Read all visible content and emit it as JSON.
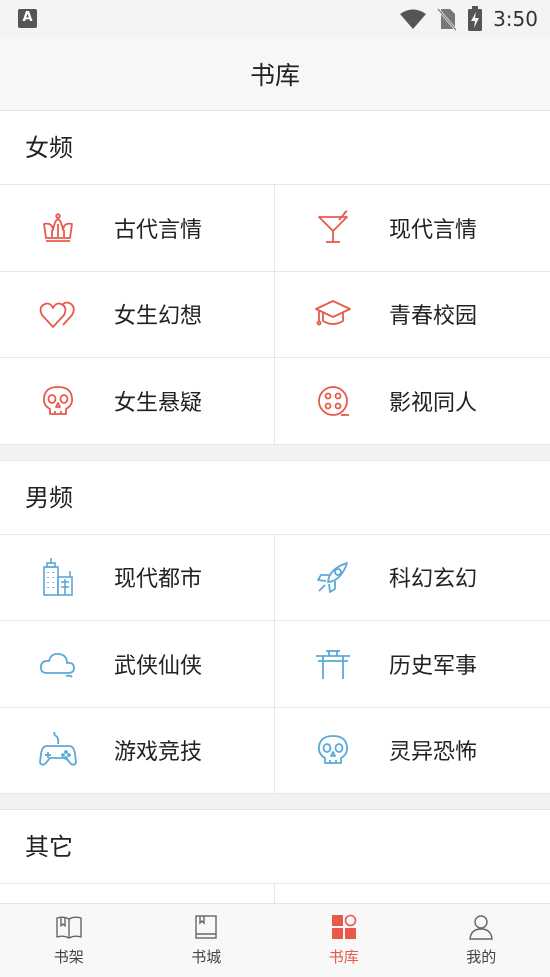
{
  "status_bar": {
    "notification_glyph": "A",
    "time": "3:50"
  },
  "header": {
    "title": "书库"
  },
  "sections": [
    {
      "title": "女频",
      "accent": "#e8594b",
      "items": [
        {
          "label": "古代言情",
          "icon": "crown-icon"
        },
        {
          "label": "现代言情",
          "icon": "cocktail-icon"
        },
        {
          "label": "女生幻想",
          "icon": "hearts-icon"
        },
        {
          "label": "青春校园",
          "icon": "graduation-cap-icon"
        },
        {
          "label": "女生悬疑",
          "icon": "skull-icon"
        },
        {
          "label": "影视同人",
          "icon": "film-reel-icon"
        }
      ]
    },
    {
      "title": "男频",
      "accent": "#5aa9d6",
      "items": [
        {
          "label": "现代都市",
          "icon": "city-buildings-icon"
        },
        {
          "label": "科幻玄幻",
          "icon": "rocket-icon"
        },
        {
          "label": "武侠仙侠",
          "icon": "cloud-icon"
        },
        {
          "label": "历史军事",
          "icon": "gate-icon"
        },
        {
          "label": "游戏竞技",
          "icon": "gamepad-icon"
        },
        {
          "label": "灵异恐怖",
          "icon": "skull-icon"
        }
      ]
    },
    {
      "title": "其它"
    }
  ],
  "tabs": [
    {
      "label": "书架",
      "icon": "open-book-icon",
      "active": false
    },
    {
      "label": "书城",
      "icon": "book-icon",
      "active": false
    },
    {
      "label": "书库",
      "icon": "library-grid-icon",
      "active": true
    },
    {
      "label": "我的",
      "icon": "user-icon",
      "active": false
    }
  ],
  "colors": {
    "accent_red": "#e8594b",
    "accent_blue": "#5aa9d6",
    "tab_inactive": "#444444"
  }
}
